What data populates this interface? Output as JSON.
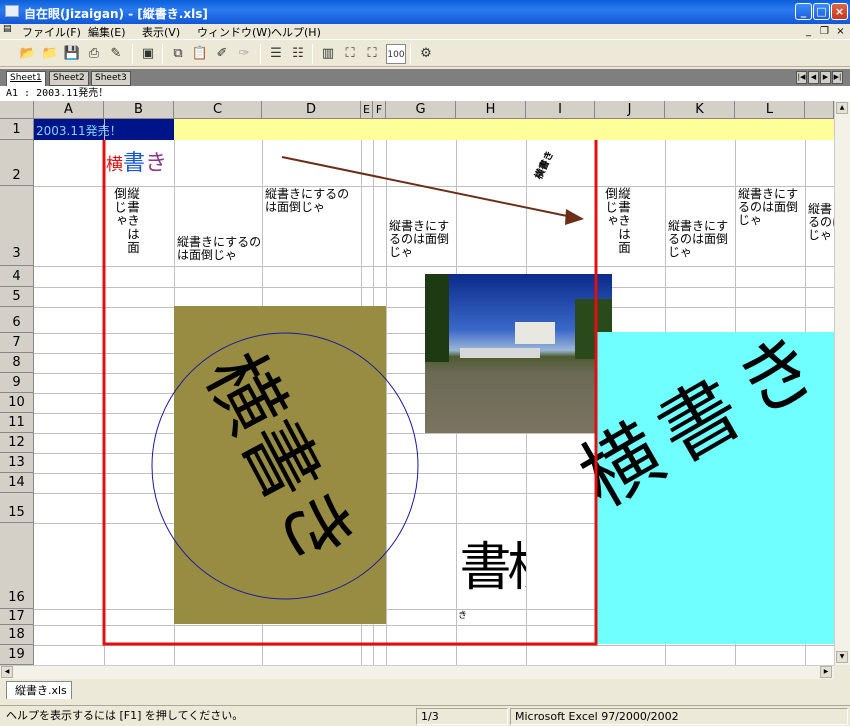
{
  "window": {
    "title": "自在眼(Jizaigan) - [縦書き.xls]",
    "btn_min": "_",
    "btn_max": "□",
    "btn_close": "×"
  },
  "menu": {
    "items": [
      "ファイル(F)",
      "編集(E)",
      "表示(V)",
      "ウィンドウ(W)",
      "ヘルプ(H)"
    ],
    "mdi_min": "_",
    "mdi_restore": "❐",
    "mdi_close": "×"
  },
  "toolbar": {
    "zoom_label": "100"
  },
  "sheet_tabs": [
    "Sheet1",
    "Sheet2",
    "Sheet3"
  ],
  "ref_bar": "A1 : 2003.11発売！",
  "columns": [
    "A",
    "B",
    "C",
    "D",
    "E",
    "F",
    "G",
    "H",
    "I",
    "J",
    "K",
    "L",
    ""
  ],
  "rows": [
    "1",
    "2",
    "3",
    "4",
    "5",
    "6",
    "7",
    "8",
    "9",
    "10",
    "11",
    "12",
    "13",
    "14",
    "15",
    "16",
    "17",
    "18",
    "19"
  ],
  "cells": {
    "a1": "2003.11発売！",
    "heading_yoko": "横",
    "heading_sho": "書",
    "heading_ki": "き",
    "b3_vertical": "縦書きは面倒じゃ",
    "c3": "縦書きにするのは面倒じゃ",
    "d3": "縦書きにするのは面倒じゃ",
    "g3": "縦書きにするのは面倒じゃ",
    "i2_rotated": "横書き",
    "j3_vertical": "縦書きは面倒じゃ",
    "k3": "縦書きにするのは面倒じゃ",
    "l3": "縦書きにするのは面倒じゃ",
    "m3": "縦書きにするのは面倒じゃ"
  },
  "shapes": {
    "olive_text": "横書き",
    "cyan_text": "横書き",
    "h16_big": "横書",
    "h16_small": "き"
  },
  "colors": {
    "olive": "#978c42",
    "cyan": "#6efffe",
    "red_frame": "#e01010",
    "yellow_row": "#ffff99",
    "arrow": "#6b2e16",
    "circle": "#1a1aa0"
  },
  "file_tab": "縦書き.xls",
  "status": {
    "help": "ヘルプを表示するには [F1] を押してください。",
    "page": "1/3",
    "format": "Microsoft Excel 97/2000/2002"
  }
}
